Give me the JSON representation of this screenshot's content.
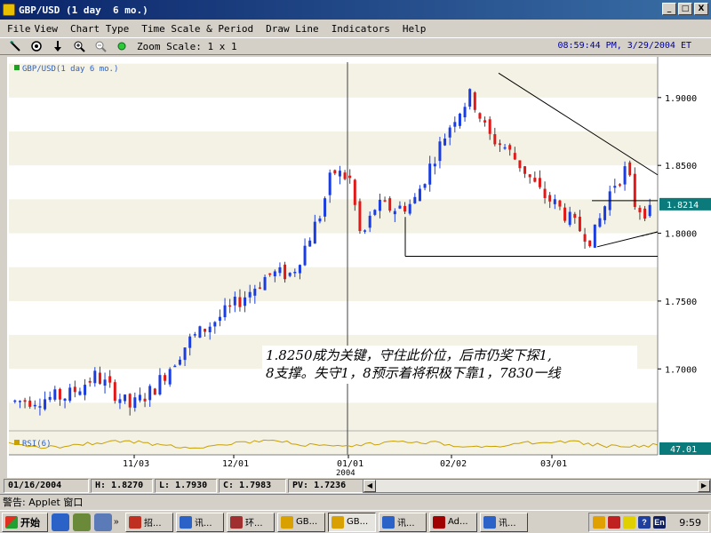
{
  "window": {
    "title": "GBP/USD (1 day  6 mo.)",
    "controls": [
      "_",
      "□",
      "X"
    ]
  },
  "menu": [
    "File",
    "View",
    "Chart Type",
    "Time Scale & Period",
    "Draw Line",
    "Indicators",
    "Help"
  ],
  "toolbar": {
    "tools": [
      "pencil-icon",
      "target-icon",
      "down-arrow-icon",
      "zoom-in-icon",
      "zoom-out-icon",
      "dot-icon"
    ],
    "zoom_label": "Zoom Scale: 1 x 1",
    "datetime": "08:59:44 PM, 3/29/2004 ET"
  },
  "chart_data": {
    "type": "candlestick",
    "legend": "GBP/USD(1 day  6 mo.)",
    "y_ticks": [
      "1.9000",
      "1.8500",
      "1.8000",
      "1.7500",
      "1.7000"
    ],
    "ylim": [
      1.655,
      1.93
    ],
    "x_ticks": [
      "11/03",
      "12/01",
      "01/01",
      "02/02",
      "03/01"
    ],
    "x_sub": "2004",
    "last_price": "1.8214",
    "rsi_label": "RSI(6)",
    "rsi_value": "47.01",
    "support_level": 1.783,
    "colors": {
      "up": "#1a3de0",
      "down": "#e01818",
      "rsi": "#c8a000",
      "price_box": "#0a7a7a"
    }
  },
  "annotation": {
    "line1": "1.8250成为关键，守住此价位，后市仍奖下探1,",
    "line2": "8支撑。失守1，8预示着将积极下靠1，7830一线"
  },
  "infobar": {
    "date": "01/16/2004",
    "high": "H: 1.8270",
    "low": "L: 1.7930",
    "close": "C: 1.7983",
    "pv": "PV: 1.7236"
  },
  "applet_status": "警告: Applet 窗口",
  "taskbar": {
    "start": "开始",
    "tasks": [
      "招...",
      "讯...",
      "环...",
      "GB...",
      "GB...",
      "讯...",
      "Ad...",
      "讯..."
    ],
    "tray_lang": "En",
    "time": "9:59"
  }
}
